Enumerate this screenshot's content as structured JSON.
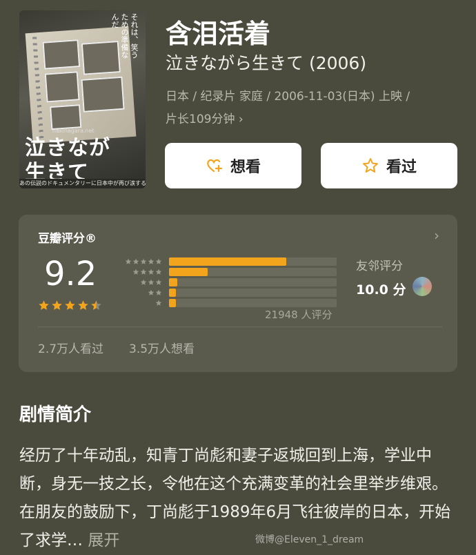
{
  "movie": {
    "title": "含泪活着",
    "original_title": "泣きながら生きて (2006)",
    "meta_line1": "日本 / 纪录片 家庭 / 2006-11-03(日本) 上映 /",
    "meta_line2": "片长109分钟 ›"
  },
  "poster": {
    "title_art_line1": "泣きなが",
    "title_art_line2": "生きて",
    "vertical_text": "それは、笑うための準備なんだ",
    "url": "nakinagara.net",
    "tagline": "あの伝説のドキュメンタリーに日本中が再び涙する"
  },
  "actions": {
    "want_label": "想看",
    "watched_label": "看过",
    "want_icon": "heart-plus-icon",
    "watched_icon": "star-outline-icon"
  },
  "rating": {
    "label": "豆瓣评分®",
    "score": "9.2",
    "stars_shown": 4.5,
    "distribution": [
      {
        "stars": 5,
        "fraction": 0.7
      },
      {
        "stars": 4,
        "fraction": 0.23
      },
      {
        "stars": 3,
        "fraction": 0.05
      },
      {
        "stars": 2,
        "fraction": 0.04
      },
      {
        "stars": 1,
        "fraction": 0.04
      }
    ],
    "count_text": "21948 人评分",
    "friends_label": "友邻评分",
    "friends_score": "10.0 分",
    "watched_text": "2.7万人看过",
    "wanted_text": "3.5万人想看"
  },
  "synopsis": {
    "heading": "剧情简介",
    "text": "经历了十年动乱，知青丁尚彪和妻子返城回到上海，学业中断，身无一技之长，令他在这个充满变革的社会里举步维艰。在朋友的鼓励下，丁尚彪于1989年6月飞往彼岸的日本，开始了求学…",
    "expand": "展开"
  },
  "watermark": "微博@Eleven_1_dream",
  "colors": {
    "background": "#4b4b3d",
    "card": "#5a5a4d",
    "accent_orange": "#f2a51c"
  }
}
